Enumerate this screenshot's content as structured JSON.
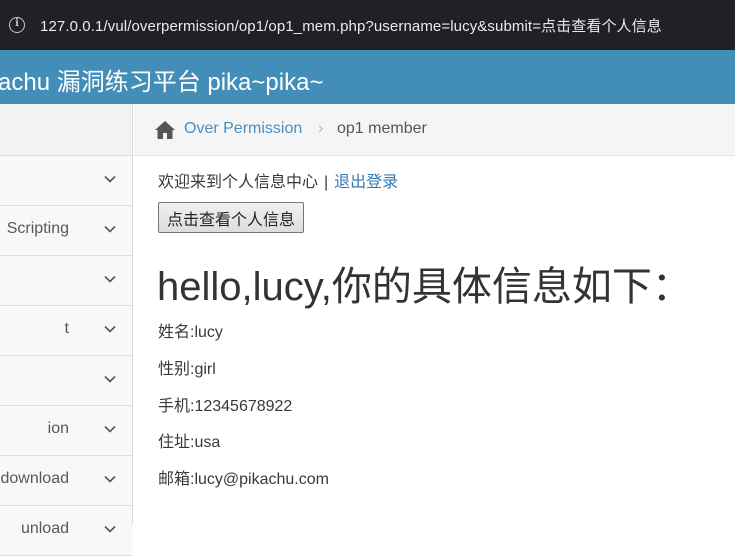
{
  "browser": {
    "url": "127.0.0.1/vul/overpermission/op1/op1_mem.php?username=lucy&submit=点击查看个人信息"
  },
  "header": {
    "title": "achu 漏洞练习平台 pika~pika~"
  },
  "sidebar": {
    "items": [
      {
        "label": ""
      },
      {
        "label": "Scripting"
      },
      {
        "label": ""
      },
      {
        "label": "t"
      },
      {
        "label": ""
      },
      {
        "label": "ion"
      },
      {
        "label": "edownload"
      },
      {
        "label": "unload"
      }
    ]
  },
  "breadcrumb": {
    "section": "Over Permission",
    "separator": "›",
    "current": "op1 member"
  },
  "main": {
    "welcome_text": "欢迎来到个人信息中心",
    "separator": "|",
    "logout_label": "退出登录",
    "view_button_label": "点击查看个人信息",
    "heading": "hello,lucy,你的具体信息如下：",
    "info": [
      "姓名:lucy",
      "性别:girl",
      "手机:12345678922",
      "住址:usa",
      "邮箱:lucy@pikachu.com"
    ]
  },
  "colors": {
    "header_bg": "#438eb9",
    "link": "#4c8fbd",
    "addressbar_bg": "#202124"
  },
  "icons": {
    "site_info": "info-icon",
    "home": "home-icon",
    "expand": "chevron-down-icon"
  }
}
